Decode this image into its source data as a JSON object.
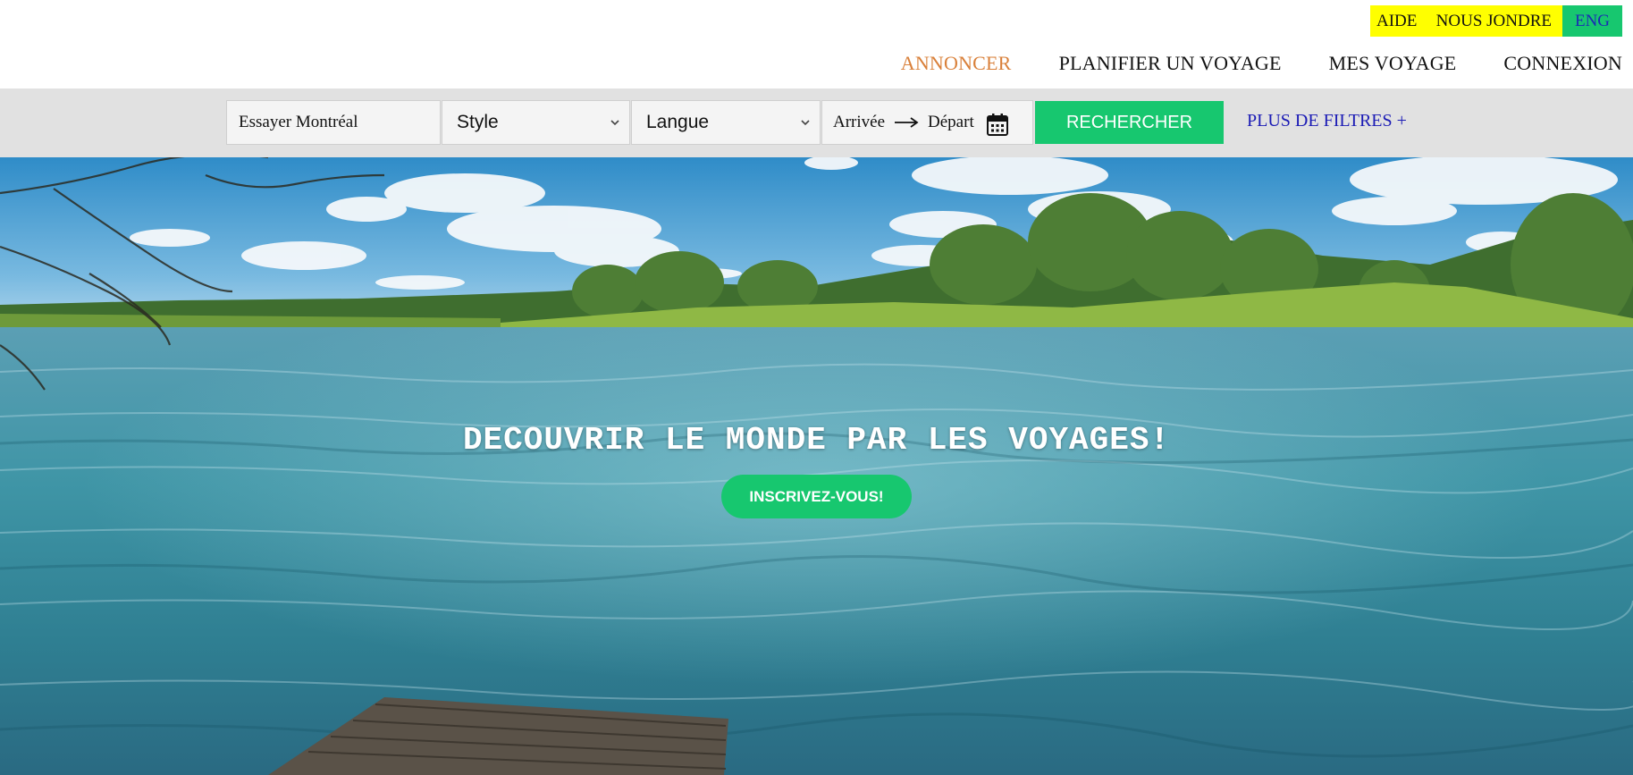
{
  "utility": {
    "help_label": "AIDE",
    "contact_label": "NOUS JONDRE",
    "language_label": "ENG"
  },
  "nav": {
    "items": [
      {
        "label": "ANNONCER",
        "active": true
      },
      {
        "label": "PLANIFIER UN VOYAGE",
        "active": false
      },
      {
        "label": "MES VOYAGE",
        "active": false
      },
      {
        "label": "CONNEXION",
        "active": false
      }
    ]
  },
  "search": {
    "destination_placeholder": "Essayer Montréal",
    "style_select": "Style",
    "language_select": "Langue",
    "arrival_label": "Arrivée",
    "departure_label": "Départ",
    "search_button": "RECHERCHER",
    "more_filters": "PLUS DE FILTRES +"
  },
  "hero": {
    "title": "DECOUVRIR LE MONDE PAR LES VOYAGES!",
    "cta_label": "INSCRIVEZ-VOUS!"
  },
  "colors": {
    "accent_green": "#17c76f",
    "utility_yellow": "#ffff00",
    "nav_active": "#d9803a",
    "link_blue": "#1b1bb5",
    "search_band": "#e1e1e1"
  },
  "icons": {
    "calendar": "calendar-icon",
    "arrow": "arrow-right-icon",
    "chevron": "chevron-down-icon"
  }
}
